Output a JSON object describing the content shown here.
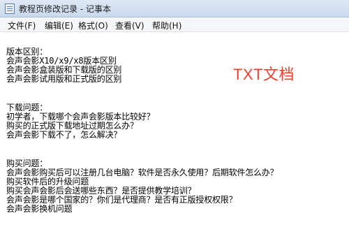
{
  "window": {
    "title": "教程页修改记录 - 记事本",
    "icon": "notepad-icon"
  },
  "menu": [
    {
      "label": "文件(F)"
    },
    {
      "label": "编辑(E)"
    },
    {
      "label": "格式(O)"
    },
    {
      "label": "查看(V)"
    },
    {
      "label": "帮助(H)"
    }
  ],
  "document": {
    "lines": [
      "版本区别：",
      "会声会影X10/x9/x8版本区别",
      "会声会影盒装版和下载版的区别",
      "会声会影试用版和正式版的区别",
      "下载问题：",
      "初学者，下载哪个会声会影版本比较好？",
      "购买的正式版下载地址过期怎么办？",
      "会声会影下载不了，怎么解决？",
      "购买问题：",
      "会声会影购买后可以注册几台电脑？软件是否永久使用？后期软件怎么办？",
      "购买软件后的升级问题",
      "购买会声会影后会送哪些东西？是否提供教学培训？",
      "会声会影是哪个国家的？你们是代理商？是否有正版授权权限？",
      "会声会影换机问题"
    ]
  },
  "annotation": {
    "text": "TXT文档",
    "color": "#e8432f"
  }
}
